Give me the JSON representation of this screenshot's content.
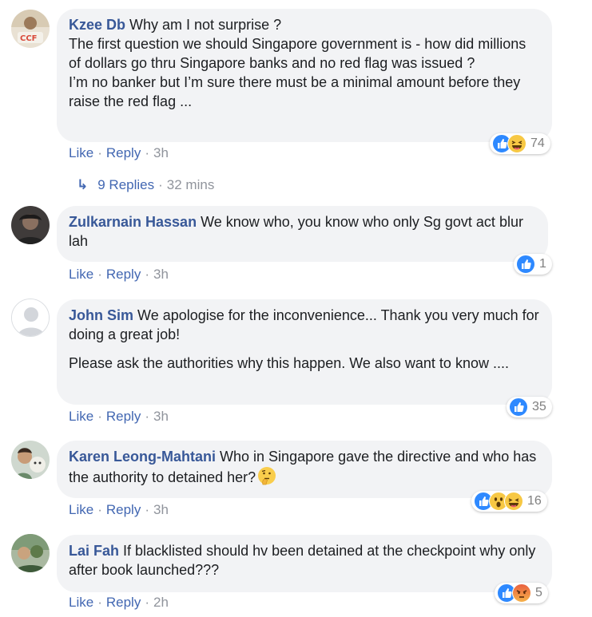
{
  "comments": [
    {
      "name": "Kzee Db",
      "paragraphs": [
        "Why am I not surprise ?\nThe first question we should Singapore government is - how did millions of dollars go thru Singapore banks and no red flag was issued ?\nI’m no banker but I’m sure there must be a minimal amount before they raise the red flag ..."
      ],
      "like": "Like",
      "reply": "Reply",
      "time": "3h",
      "reactions": [
        "like",
        "haha"
      ],
      "reaction_count": "74"
    },
    {
      "name": "Zulkarnain Hassan",
      "paragraphs": [
        "We know who, you know who only Sg govt act blur lah"
      ],
      "like": "Like",
      "reply": "Reply",
      "time": "3h",
      "reactions": [
        "like"
      ],
      "reaction_count": "1"
    },
    {
      "name": "John Sim",
      "paragraphs": [
        "We apologise for the inconvenience... Thank you very much for doing a great job!",
        "Please ask the authorities why this happen. We also want to know ...."
      ],
      "like": "Like",
      "reply": "Reply",
      "time": "3h",
      "reactions": [
        "like"
      ],
      "reaction_count": "35"
    },
    {
      "name": "Karen Leong-Mahtani",
      "paragraphs": [
        "Who in Singapore gave the directive and who has the authority to detained her?"
      ],
      "inline_emoji": "thinking-face",
      "like": "Like",
      "reply": "Reply",
      "time": "3h",
      "reactions": [
        "like",
        "wow",
        "haha"
      ],
      "reaction_count": "16"
    },
    {
      "name": "Lai Fah",
      "paragraphs": [
        "If blacklisted should hv been detained at the checkpoint why only after book launched???"
      ],
      "like": "Like",
      "reply": "Reply",
      "time": "2h",
      "reactions": [
        "like",
        "angry"
      ],
      "reaction_count": "5"
    }
  ],
  "replies_thread": {
    "label": "9 Replies",
    "time": "32 mins"
  },
  "separator": "·",
  "colors": {
    "name": "#385898",
    "link": "#4267b2",
    "meta": "#90949c",
    "bubble": "#f2f3f5",
    "like_blue": "#2e89ff"
  }
}
